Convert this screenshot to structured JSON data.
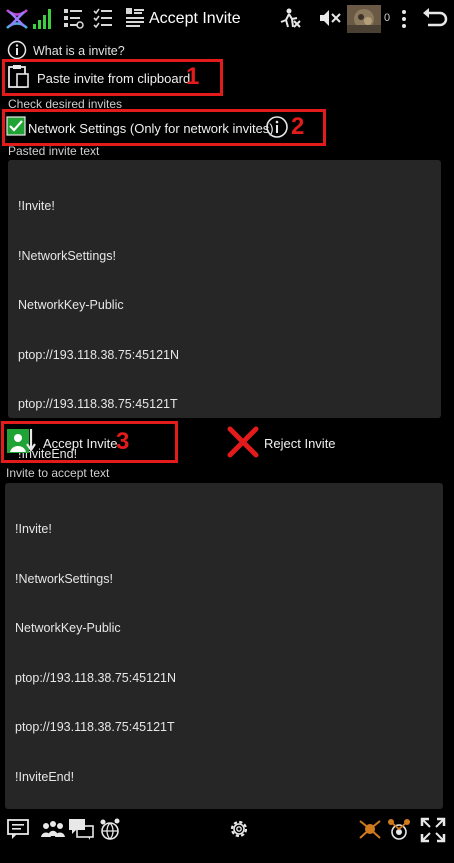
{
  "header": {
    "title": "Accept Invite",
    "peer_count": "0"
  },
  "help": {
    "label": "What is a invite?"
  },
  "paste": {
    "label": "Paste invite from clipboard"
  },
  "check_section": {
    "label": "Check desired invites"
  },
  "network_checkbox": {
    "label": "Network Settings (Only for network invites)",
    "checked": true
  },
  "pasted": {
    "label": "Pasted invite text",
    "lines": [
      "!Invite!",
      "!NetworkSettings!",
      "NetworkKey-Public",
      "ptop://193.118.38.75:45121N",
      "ptop://193.118.38.75:45121T",
      "!InviteEnd!"
    ]
  },
  "actions": {
    "accept_label": "Accept Invite",
    "reject_label": "Reject Invite"
  },
  "accept_text": {
    "label": "Invite to accept text",
    "lines": [
      "!Invite!",
      "!NetworkSettings!",
      "NetworkKey-Public",
      "ptop://193.118.38.75:45121N",
      "ptop://193.118.38.75:45121T",
      "!InviteEnd!"
    ]
  },
  "annotations": {
    "n1": "1",
    "n2": "2",
    "n3": "3"
  },
  "colors": {
    "annotation_red": "#e31b1b",
    "check_green": "#1fa335",
    "signal_green": "#3ecf3e",
    "panel_bg": "#262626"
  }
}
